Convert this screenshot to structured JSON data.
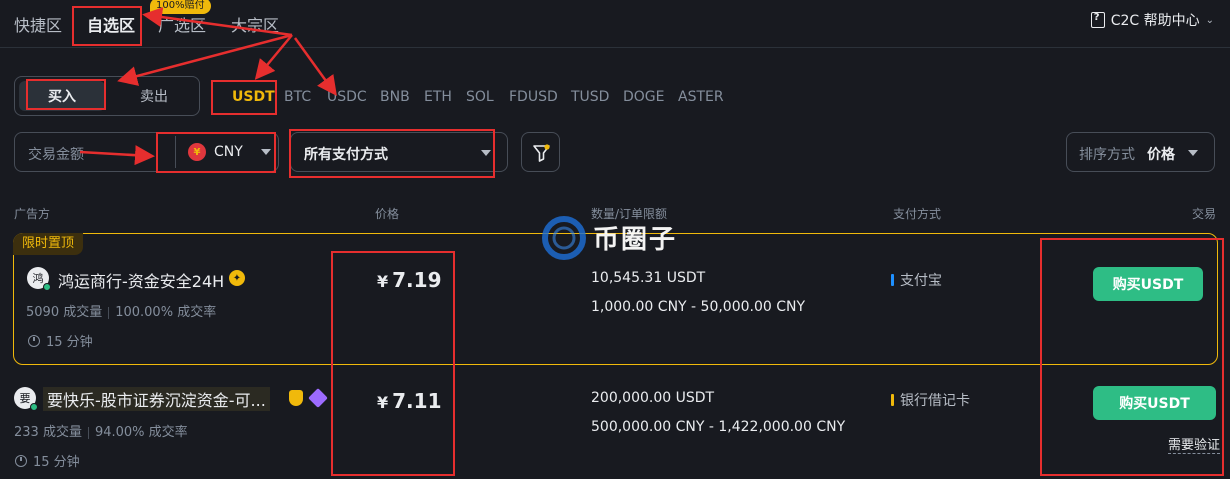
{
  "nav": {
    "tabs": [
      "快捷区",
      "自选区",
      "广选区",
      "大宗区"
    ],
    "promo_badge": "100%赔付",
    "help_center": "C2C 帮助中心"
  },
  "trade_side": {
    "buy": "买入",
    "sell": "卖出"
  },
  "coins": [
    "USDT",
    "BTC",
    "USDC",
    "BNB",
    "ETH",
    "SOL",
    "FDUSD",
    "TUSD",
    "DOGE",
    "ASTER"
  ],
  "filters": {
    "amount_placeholder": "交易金额",
    "currency": "CNY",
    "currency_symbol": "¥",
    "payment_method": "所有支付方式",
    "sort_label": "排序方式",
    "sort_value": "价格"
  },
  "table_headers": {
    "advertiser": "广告方",
    "price": "价格",
    "quantity_limit": "数量/订单限额",
    "payment": "支付方式",
    "trade": "交易"
  },
  "pinned_tag": "限时置顶",
  "watermark": "币圈子",
  "ads": [
    {
      "avatar": "鸿",
      "name": "鸿运商行-资金安全24H",
      "orders": "5090 成交量",
      "completion": "100.00% 成交率",
      "time": "15 分钟",
      "currency_sign": "¥",
      "price": "7.19",
      "available": "10,545.31 USDT",
      "limit": "1,000.00 CNY - 50,000.00 CNY",
      "payment": "支付宝",
      "payment_color": "#1e90ff",
      "action": "购买USDT"
    },
    {
      "avatar": "要",
      "name": "要快乐-股市证券沉淀资金-可...",
      "orders": "233 成交量",
      "completion": "94.00% 成交率",
      "time": "15 分钟",
      "currency_sign": "¥",
      "price": "7.11",
      "available": "200,000.00 USDT",
      "limit": "500,000.00 CNY - 1,422,000.00 CNY",
      "payment": "银行借记卡",
      "payment_color": "#f0b90b",
      "action": "购买USDT",
      "note": "需要验证"
    }
  ],
  "colors": {
    "background": "#181a20",
    "accent": "#f0b90b",
    "buy_green": "#2ebd85",
    "annotation_red": "#e62e2e"
  }
}
